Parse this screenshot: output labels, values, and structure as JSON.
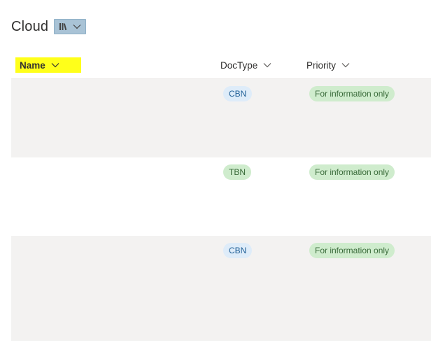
{
  "header": {
    "title": "Cloud",
    "library_switcher": {
      "icon": "library-icon",
      "chevron": "chevron-down-icon"
    }
  },
  "columns": [
    {
      "label": "Name",
      "icon": "chevron-down-icon",
      "highlighted": true,
      "highlight_color": "#ffff1a"
    },
    {
      "label": "DocType",
      "icon": "chevron-down-icon"
    },
    {
      "label": "Priority",
      "icon": "chevron-down-icon"
    }
  ],
  "rows": [
    {
      "name": "",
      "doctype": {
        "label": "CBN",
        "bg": "#deecf9",
        "color": "#1f5f96"
      },
      "priority": {
        "label": "For information only",
        "bg": "#cfeccd",
        "color": "#3a6b3a"
      }
    },
    {
      "name": "",
      "doctype": {
        "label": "TBN",
        "bg": "#cfeccd",
        "color": "#3a6b3a"
      },
      "priority": {
        "label": "For information only",
        "bg": "#cfeccd",
        "color": "#3a6b3a"
      }
    },
    {
      "name": "",
      "doctype": {
        "label": "CBN",
        "bg": "#deecf9",
        "color": "#1f5f96"
      },
      "priority": {
        "label": "For information only",
        "bg": "#cfeccd",
        "color": "#3a6b3a"
      }
    }
  ],
  "colors": {
    "row_shade": "#f3f2f1",
    "switcher_bg": "#a9c3d6"
  }
}
